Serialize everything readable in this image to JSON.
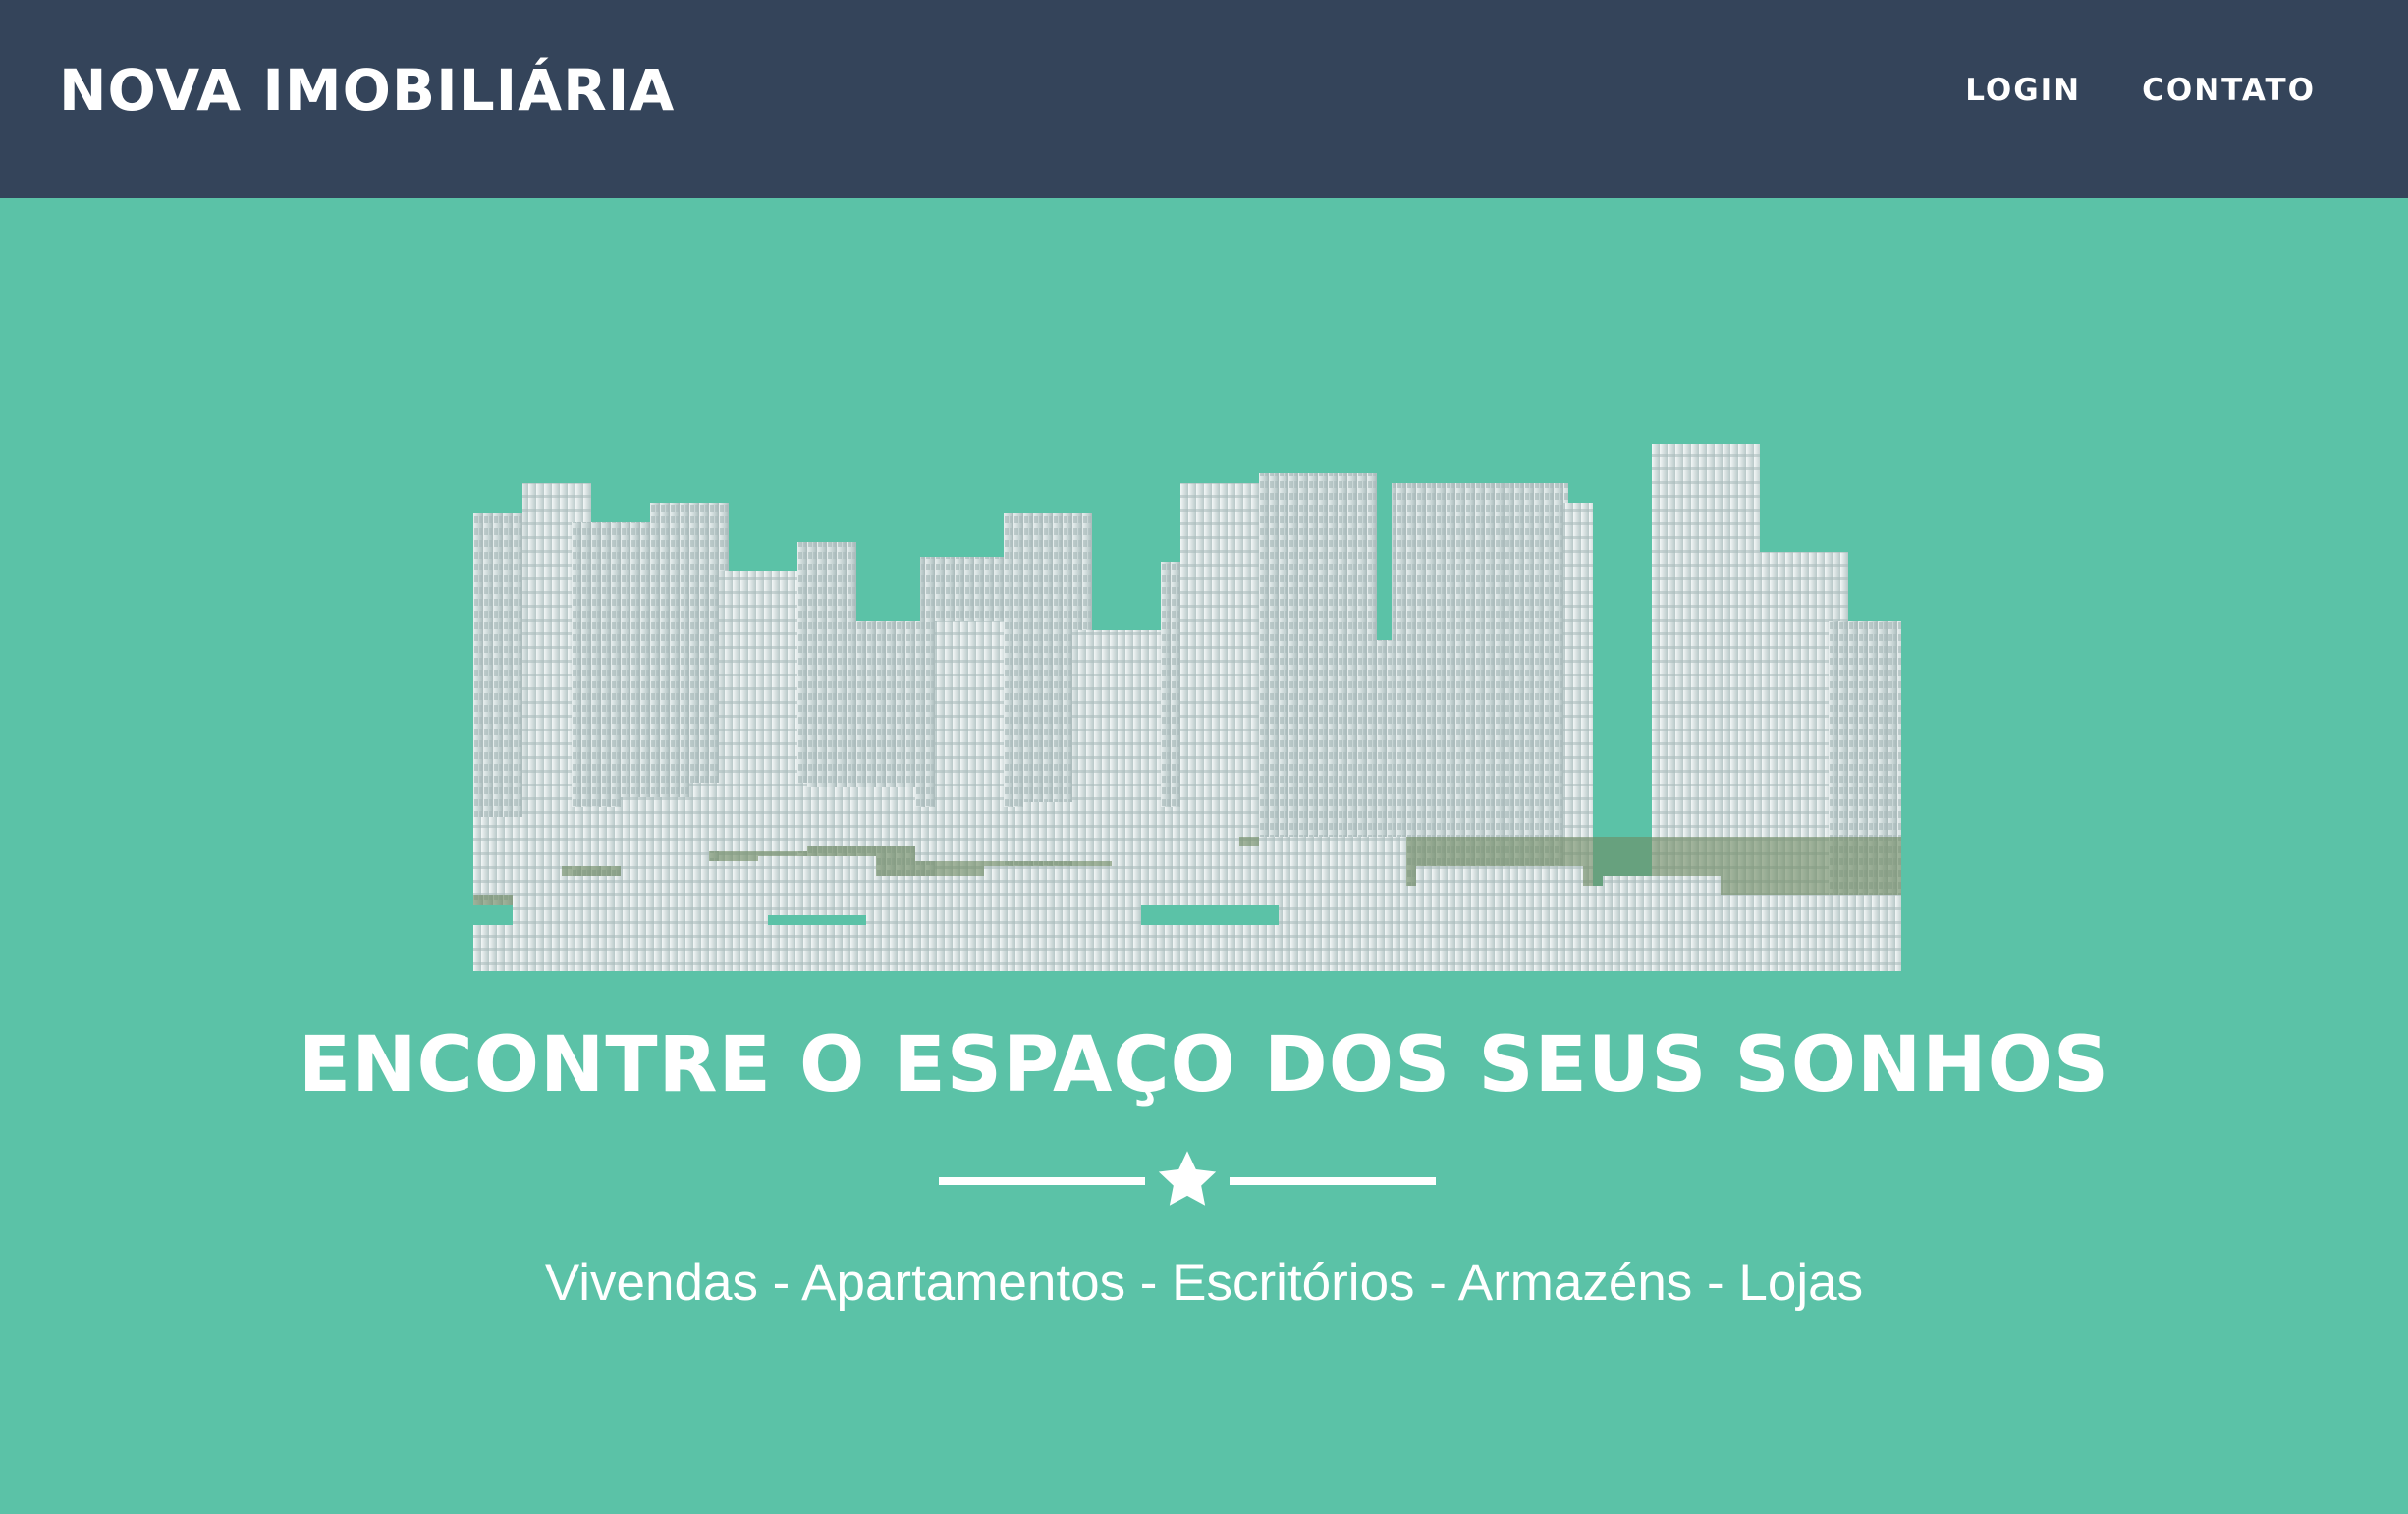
{
  "navbar": {
    "brand": "NOVA IMOBILIÁRIA",
    "links": [
      {
        "label": "LOGIN"
      },
      {
        "label": "CONTATO"
      }
    ]
  },
  "hero": {
    "image_description_icon": "city-skyline-image",
    "headline": "ENCONTRE O ESPAÇO DOS SEUS SONHOS",
    "divider_icon": "star-icon",
    "subtitle": "Vivendas - Apartamentos - Escritórios - Armazéns - Lojas"
  },
  "colors": {
    "navbar_bg": "#34445a",
    "hero_bg": "#5bc2a7",
    "text": "#ffffff"
  }
}
